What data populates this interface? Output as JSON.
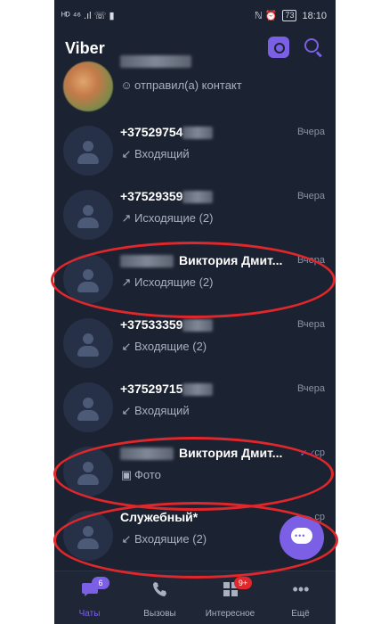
{
  "status_bar": {
    "time": "18:10",
    "battery": "73",
    "left_icons": "ᴴᴰ ⁴⁶ .ıl ☏ ▮",
    "right_icons": "ℕ ⏰"
  },
  "header": {
    "title": "Viber"
  },
  "chats": [
    {
      "name": "",
      "subtitle": "отправил(а) контакт",
      "time": "",
      "sub_icon": "contact-icon",
      "avatar": "photo"
    },
    {
      "name": "+37529754",
      "subtitle": "Входящий",
      "time": "Вчера",
      "sub_icon": "incoming-arrow-icon",
      "avatar": "default"
    },
    {
      "name": "+37529359",
      "subtitle": "Исходящие (2)",
      "time": "Вчера",
      "sub_icon": "outgoing-arrow-icon",
      "avatar": "default"
    },
    {
      "name": "Виктория Дмит...",
      "subtitle": "Исходящие (2)",
      "time": "Вчера",
      "sub_icon": "outgoing-arrow-icon",
      "avatar": "default"
    },
    {
      "name": "+37533359",
      "subtitle": "Входящие (2)",
      "time": "Вчера",
      "sub_icon": "incoming-arrow-icon",
      "avatar": "default"
    },
    {
      "name": "+37529715",
      "subtitle": "Входящий",
      "time": "Вчера",
      "sub_icon": "incoming-arrow-icon",
      "avatar": "default"
    },
    {
      "name": "Виктория Дмит...",
      "subtitle": "Фото",
      "time": "ср",
      "sub_icon": "photo-icon",
      "avatar": "default"
    },
    {
      "name": "Служебный*",
      "subtitle": "Входящие (2)",
      "time": "ср",
      "sub_icon": "incoming-arrow-icon",
      "avatar": "default"
    }
  ],
  "bottom_nav": [
    {
      "label": "Чаты",
      "badge": "6",
      "icon": "chat-icon",
      "active": true
    },
    {
      "label": "Вызовы",
      "badge": "",
      "icon": "phone-icon",
      "active": false
    },
    {
      "label": "Интересное",
      "badge": "9+",
      "icon": "explore-icon",
      "active": false
    },
    {
      "label": "Ещё",
      "badge": "",
      "icon": "more-icon",
      "active": false
    }
  ],
  "colors": {
    "accent": "#7b60e6",
    "background": "#1b2231",
    "annotation": "#e0272b",
    "badge_red": "#e0272b"
  }
}
